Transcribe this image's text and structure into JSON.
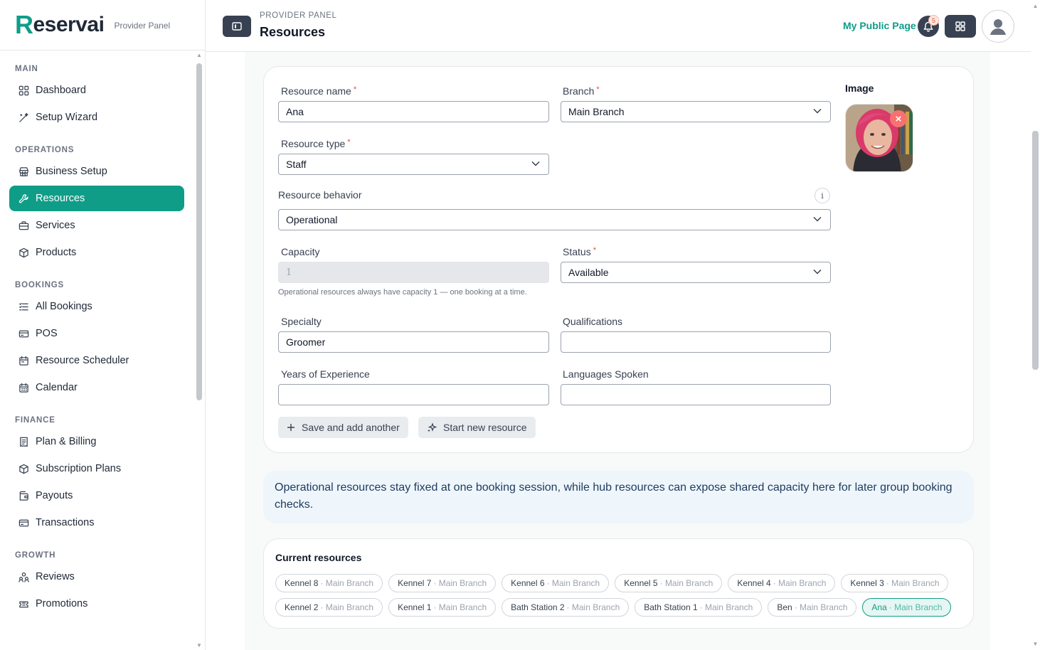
{
  "brand": {
    "logo_initial": "R",
    "logo_rest": "eservai",
    "subtitle": "Provider Panel"
  },
  "sidebar": {
    "sections": [
      {
        "title": "MAIN",
        "items": [
          {
            "label": "Dashboard",
            "icon": "grid-icon"
          },
          {
            "label": "Setup Wizard",
            "icon": "wand-icon"
          }
        ]
      },
      {
        "title": "OPERATIONS",
        "items": [
          {
            "label": "Business Setup",
            "icon": "store-icon"
          },
          {
            "label": "Resources",
            "icon": "wrench-icon",
            "active": true
          },
          {
            "label": "Services",
            "icon": "briefcase-icon"
          },
          {
            "label": "Products",
            "icon": "box-icon"
          }
        ]
      },
      {
        "title": "BOOKINGS",
        "items": [
          {
            "label": "All Bookings",
            "icon": "list-icon"
          },
          {
            "label": "POS",
            "icon": "card-icon"
          },
          {
            "label": "Resource Scheduler",
            "icon": "calendar-icon"
          },
          {
            "label": "Calendar",
            "icon": "calendar-grid-icon"
          }
        ]
      },
      {
        "title": "FINANCE",
        "items": [
          {
            "label": "Plan & Billing",
            "icon": "receipt-icon"
          },
          {
            "label": "Subscription Plans",
            "icon": "box-icon"
          },
          {
            "label": "Payouts",
            "icon": "wallet-icon"
          },
          {
            "label": "Transactions",
            "icon": "card-icon"
          }
        ]
      },
      {
        "title": "GROWTH",
        "items": [
          {
            "label": "Reviews",
            "icon": "users-icon"
          },
          {
            "label": "Promotions",
            "icon": "ticket-icon"
          }
        ]
      }
    ]
  },
  "header": {
    "subtitle": "PROVIDER PANEL",
    "title": "Resources",
    "public_page_label": "My Public Page",
    "notification_count": "5"
  },
  "form": {
    "resource_name": {
      "label": "Resource name",
      "value": "Ana"
    },
    "branch": {
      "label": "Branch",
      "value": "Main Branch"
    },
    "resource_type": {
      "label": "Resource type",
      "value": "Staff"
    },
    "resource_behavior": {
      "label": "Resource behavior",
      "value": "Operational"
    },
    "capacity": {
      "label": "Capacity",
      "value": "1",
      "hint": "Operational resources always have capacity 1 — one booking at a time."
    },
    "status": {
      "label": "Status",
      "value": "Available"
    },
    "specialty": {
      "label": "Specialty",
      "value": "Groomer"
    },
    "qualifications": {
      "label": "Qualifications",
      "value": ""
    },
    "years_experience": {
      "label": "Years of Experience",
      "value": ""
    },
    "languages": {
      "label": "Languages Spoken",
      "value": ""
    },
    "image_label": "Image",
    "required_mark": "*",
    "save_add_label": "Save and add another",
    "start_new_label": "Start new resource"
  },
  "note": "Operational resources stay fixed at one booking session, while hub resources can expose shared capacity here for later group booking checks.",
  "resources": {
    "title": "Current resources",
    "items": [
      {
        "name": "Kennel 8",
        "branch": "· Main Branch"
      },
      {
        "name": "Kennel 7",
        "branch": "· Main Branch"
      },
      {
        "name": "Kennel 6",
        "branch": "· Main Branch"
      },
      {
        "name": "Kennel 5",
        "branch": "· Main Branch"
      },
      {
        "name": "Kennel 4",
        "branch": "· Main Branch"
      },
      {
        "name": "Kennel 3",
        "branch": "· Main Branch"
      },
      {
        "name": "Kennel 2",
        "branch": "· Main Branch"
      },
      {
        "name": "Kennel 1",
        "branch": "· Main Branch"
      },
      {
        "name": "Bath Station 2",
        "branch": "· Main Branch"
      },
      {
        "name": "Bath Station 1",
        "branch": "· Main Branch"
      },
      {
        "name": "Ben",
        "branch": "· Main Branch"
      },
      {
        "name": "Ana",
        "branch": "· Main Branch",
        "active": true
      }
    ]
  },
  "colors": {
    "accent": "#0f9d88",
    "dark": "#374151",
    "required": "#ef4444"
  }
}
